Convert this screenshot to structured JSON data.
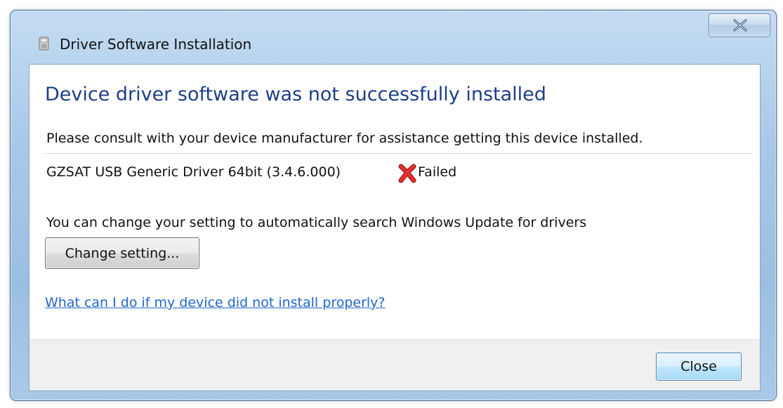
{
  "window": {
    "title": "Driver Software Installation",
    "close_glyph": "X"
  },
  "main": {
    "heading": "Device driver software was not successfully installed",
    "consult_text": "Please consult with your device manufacturer for assistance getting this device installed.",
    "driver": {
      "name": "GZSAT USB Generic Driver 64bit (3.4.6.000)",
      "status": "Failed",
      "status_icon": "red-x-icon"
    },
    "update_text": "You can change your setting to automatically search Windows Update for drivers",
    "change_setting_label": "Change setting...",
    "help_link": "What can I do if my device did not install properly?"
  },
  "footer": {
    "close_label": "Close"
  },
  "colors": {
    "heading": "#1e3d8a",
    "link": "#2266cc",
    "failed_x": "#d42020"
  }
}
